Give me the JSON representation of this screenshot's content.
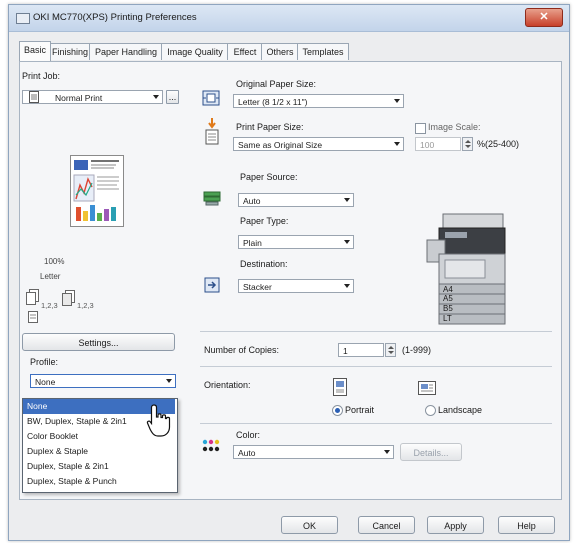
{
  "window": {
    "title": "OKI MC770(XPS) Printing Preferences",
    "close_glyph": "✕"
  },
  "tabs": [
    {
      "label": "Basic"
    },
    {
      "label": "Finishing"
    },
    {
      "label": "Paper Handling"
    },
    {
      "label": "Image Quality"
    },
    {
      "label": "Effect"
    },
    {
      "label": "Others"
    },
    {
      "label": "Templates"
    }
  ],
  "print_job": {
    "label": "Print Job:",
    "value": "Normal Print",
    "more_label": "..."
  },
  "preview": {
    "zoom": "100%",
    "paper": "Letter",
    "layout_a": "1,2,3",
    "layout_b": "1,2,3"
  },
  "settings_button": "Settings...",
  "profile": {
    "label": "Profile:",
    "value": "None",
    "options": [
      "None",
      "BW, Duplex, Staple & 2in1",
      "Color Booklet",
      "Duplex & Staple",
      "Duplex, Staple & 2in1",
      "Duplex, Staple & Punch"
    ]
  },
  "original_paper_size": {
    "label": "Original Paper Size:",
    "value": "Letter (8 1/2 x 11\")"
  },
  "print_paper_size": {
    "label": "Print Paper Size:",
    "value": "Same as Original Size"
  },
  "image_scale": {
    "label": "Image Scale:",
    "value": "100",
    "range": "%(25-400)"
  },
  "paper_source": {
    "label": "Paper Source:",
    "value": "Auto"
  },
  "paper_type": {
    "label": "Paper Type:",
    "value": "Plain"
  },
  "destination": {
    "label": "Destination:",
    "value": "Stacker"
  },
  "trays": [
    "A4",
    "A5",
    "B5",
    "LT"
  ],
  "copies": {
    "label": "Number of Copies:",
    "value": "1",
    "range": "(1-999)"
  },
  "orientation": {
    "label": "Orientation:",
    "portrait": "Portrait",
    "landscape": "Landscape"
  },
  "color": {
    "label": "Color:",
    "value": "Auto",
    "details_label": "Details..."
  },
  "footer": {
    "ok": "OK",
    "cancel": "Cancel",
    "apply": "Apply",
    "help": "Help"
  },
  "colors": {
    "selection": "#3d6fc0",
    "accent": "#2b5fb4",
    "close": "#c7402a"
  }
}
